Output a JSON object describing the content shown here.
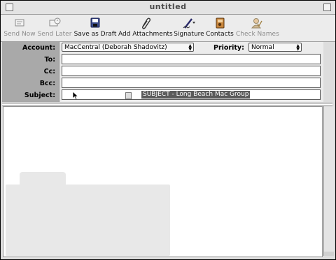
{
  "window": {
    "title": "untitled"
  },
  "toolbar": {
    "items": [
      {
        "label": "Send Now",
        "icon": "send-now-icon",
        "enabled": false
      },
      {
        "label": "Send Later",
        "icon": "send-later-icon",
        "enabled": false
      },
      {
        "label": "Save as Draft",
        "icon": "save-draft-icon",
        "enabled": true
      },
      {
        "label": "Add Attachments",
        "icon": "paperclip-icon",
        "enabled": true
      },
      {
        "label": "Signature",
        "icon": "signature-pen-icon",
        "enabled": true
      },
      {
        "label": "Contacts",
        "icon": "contacts-icon",
        "enabled": true
      },
      {
        "label": "Check Names",
        "icon": "check-names-icon",
        "enabled": false
      }
    ]
  },
  "header": {
    "account_label": "Account:",
    "account_value": "MacCentral (Deborah Shadovitz)",
    "priority_label": "Priority:",
    "priority_value": "Normal",
    "to_label": "To:",
    "to_value": "",
    "cc_label": "Cc:",
    "cc_value": "",
    "bcc_label": "Bcc:",
    "bcc_value": "",
    "subject_label": "Subject:",
    "subject_value": "SUBJECT - Long Beach Mac Group"
  },
  "colors": {
    "selection": "#5b5b5b",
    "label_column": "#a9a9a9"
  }
}
